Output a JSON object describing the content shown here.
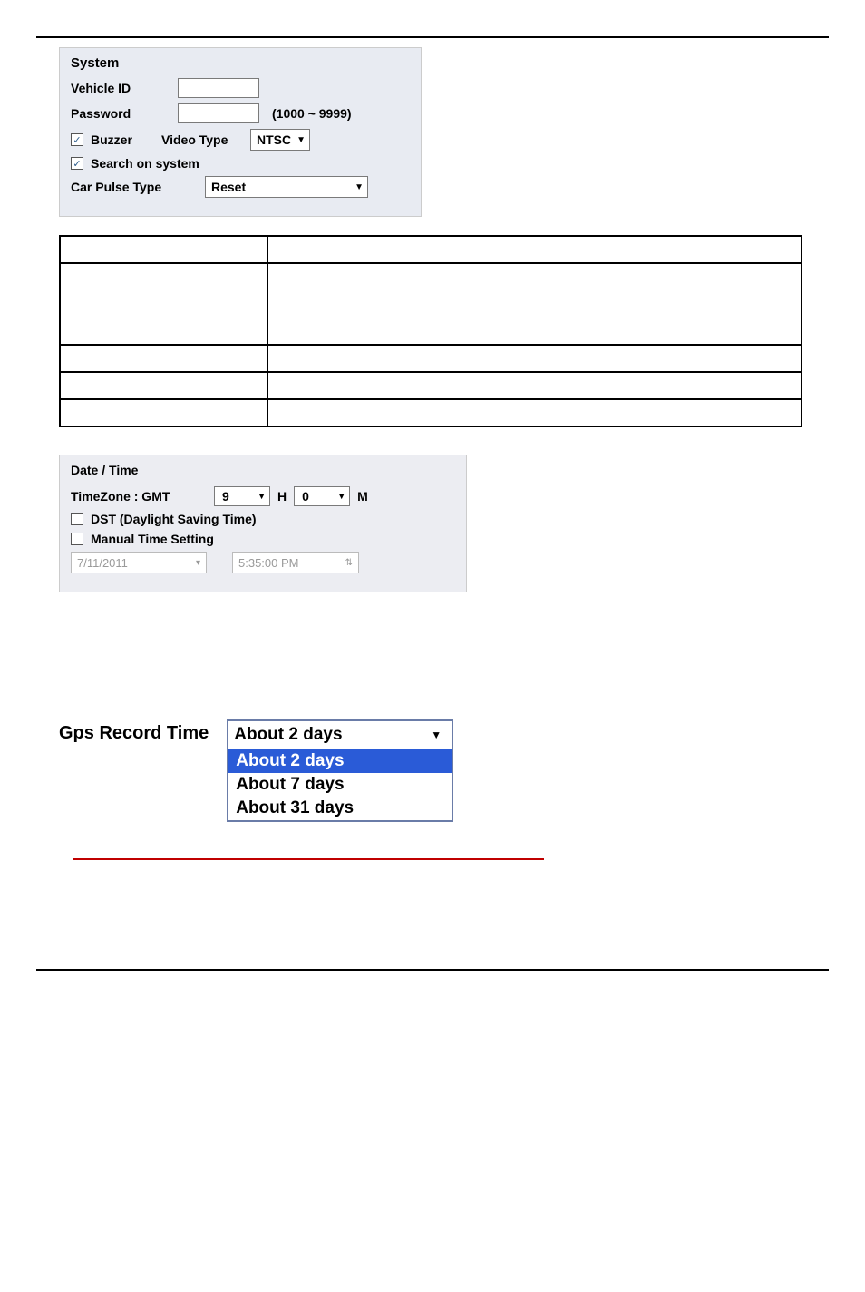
{
  "system": {
    "title": "System",
    "vehicle_id_label": "Vehicle ID",
    "password_label": "Password",
    "password_range": "(1000 ~ 9999)",
    "buzzer_label": "Buzzer",
    "video_type_label": "Video Type",
    "video_type_value": "NTSC",
    "search_label": "Search on system",
    "car_pulse_label": "Car Pulse Type",
    "car_pulse_value": "Reset"
  },
  "opts_table": {
    "rows": [
      {
        "left": "",
        "right": ""
      },
      {
        "left": "",
        "right": ""
      },
      {
        "left": "",
        "right": ""
      },
      {
        "left": "",
        "right": ""
      },
      {
        "left": "",
        "right": ""
      }
    ]
  },
  "datetime": {
    "title": "Date / Time",
    "tz_label": "TimeZone : GMT",
    "tz_h": "9",
    "tz_h_suffix": "H",
    "tz_m": "0",
    "tz_m_suffix": "M",
    "dst_label": "DST (Daylight Saving Time)",
    "manual_label": "Manual Time Setting",
    "date_value": "7/11/2011",
    "time_value": "5:35:00 PM"
  },
  "gps": {
    "label": "Gps Record Time",
    "selected": "About 2 days",
    "options": [
      "About 2 days",
      "About 7 days",
      "About 31 days"
    ]
  }
}
